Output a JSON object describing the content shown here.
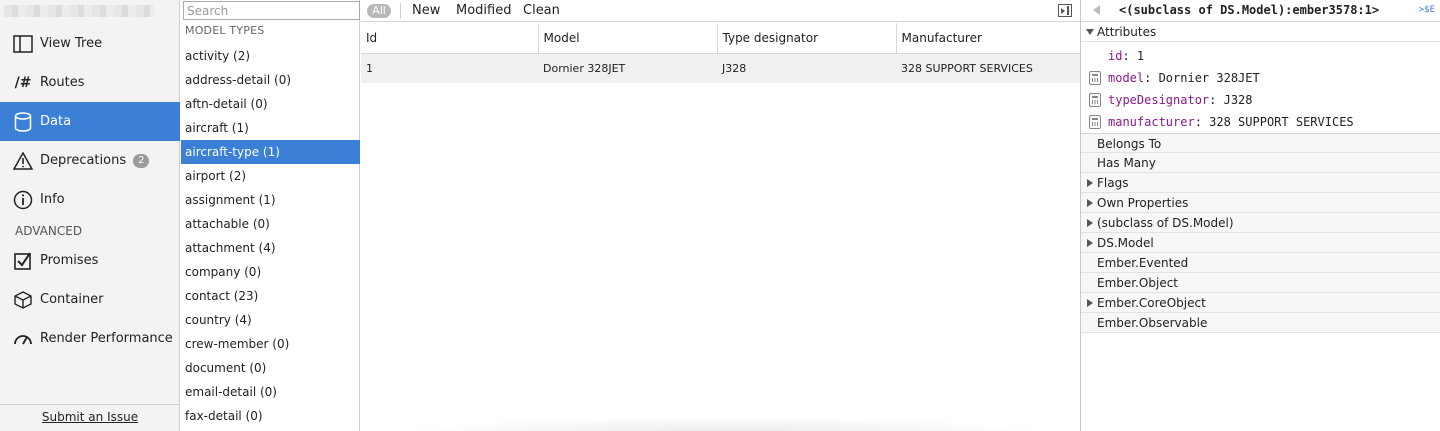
{
  "sidebar": {
    "items": [
      {
        "label": "View Tree",
        "icon": "view-tree-icon"
      },
      {
        "label": "Routes",
        "icon": "routes-icon"
      },
      {
        "label": "Data",
        "icon": "data-icon"
      },
      {
        "label": "Deprecations",
        "icon": "deprecations-icon",
        "badge": "2"
      },
      {
        "label": "Info",
        "icon": "info-icon"
      }
    ],
    "section_label": "ADVANCED",
    "advanced_items": [
      {
        "label": "Promises",
        "icon": "promises-icon"
      },
      {
        "label": "Container",
        "icon": "container-icon"
      },
      {
        "label": "Render Performance",
        "icon": "render-performance-icon"
      }
    ],
    "footer_link": "Submit an Issue",
    "active_item": "Data",
    "accent_color": "#3b80d6"
  },
  "model_types": {
    "search_placeholder": "Search",
    "title": "MODEL TYPES",
    "items": [
      "activity (2)",
      "address-detail (0)",
      "aftn-detail (0)",
      "aircraft (1)",
      "aircraft-type (1)",
      "airport (2)",
      "assignment (1)",
      "attachable (0)",
      "attachment (4)",
      "company (0)",
      "contact (23)",
      "country (4)",
      "crew-member (0)",
      "document (0)",
      "email-detail (0)",
      "fax-detail (0)"
    ],
    "selected": "aircraft-type (1)"
  },
  "toolbar": {
    "all_label": "All",
    "new_label": "New",
    "modified_label": "Modified",
    "clean_label": "Clean"
  },
  "records": {
    "columns": [
      "Id",
      "Model",
      "Type designator",
      "Manufacturer"
    ],
    "rows": [
      [
        "1",
        "Dornier 328JET",
        "J328",
        "328 SUPPORT SERVICES"
      ]
    ]
  },
  "inspector": {
    "title": "<(subclass of DS.Model):ember3578:1>",
    "dollar_e": ">$E",
    "attributes_label": "Attributes",
    "attributes": [
      {
        "key": "id",
        "value": "1",
        "computed": false
      },
      {
        "key": "model",
        "value": "Dornier 328JET",
        "computed": true
      },
      {
        "key": "typeDesignator",
        "value": "J328",
        "computed": true
      },
      {
        "key": "manufacturer",
        "value": "328 SUPPORT SERVICES",
        "computed": true
      }
    ],
    "groups": [
      {
        "label": "Belongs To",
        "expandable": false
      },
      {
        "label": "Has Many",
        "expandable": false
      },
      {
        "label": "Flags",
        "expandable": true
      },
      {
        "label": "Own Properties",
        "expandable": true
      },
      {
        "label": "(subclass of DS.Model)",
        "expandable": true
      },
      {
        "label": "DS.Model",
        "expandable": true
      },
      {
        "label": "Ember.Evented",
        "expandable": false
      },
      {
        "label": "Ember.Object",
        "expandable": false
      },
      {
        "label": "Ember.CoreObject",
        "expandable": true
      },
      {
        "label": "Ember.Observable",
        "expandable": false
      }
    ]
  }
}
